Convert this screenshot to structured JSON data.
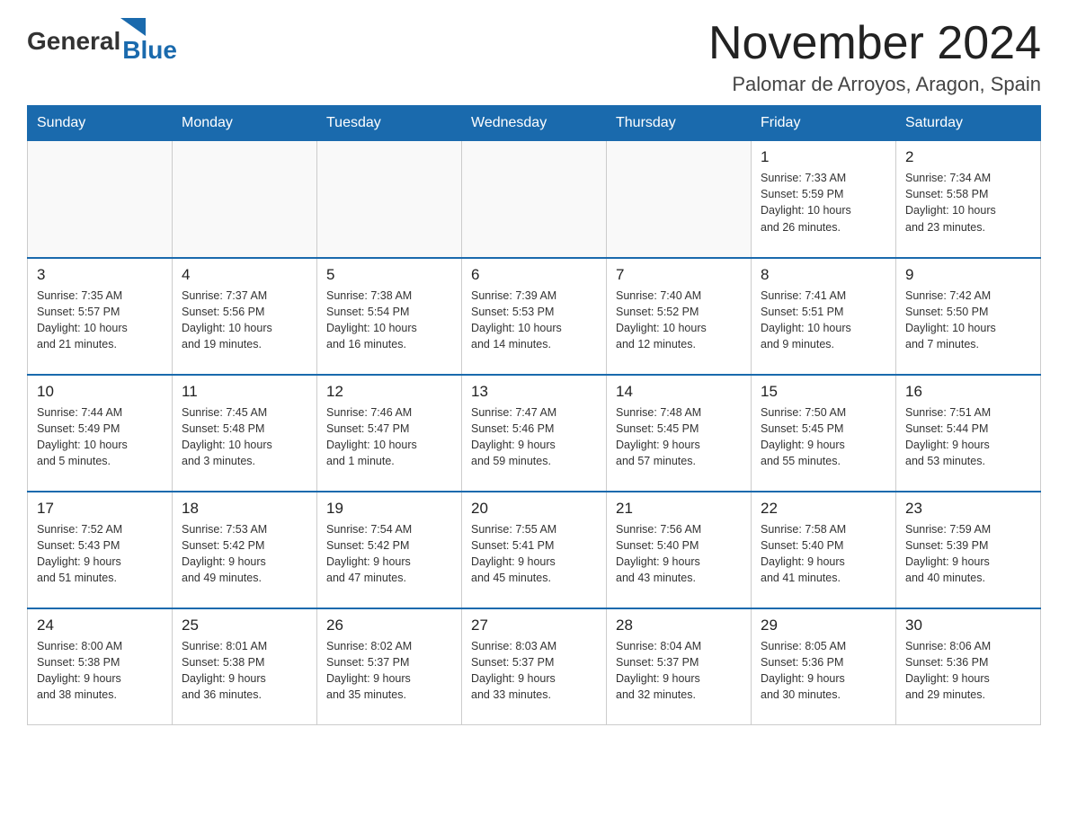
{
  "header": {
    "logo_general": "General",
    "logo_blue": "Blue",
    "month_title": "November 2024",
    "location": "Palomar de Arroyos, Aragon, Spain"
  },
  "days_of_week": [
    "Sunday",
    "Monday",
    "Tuesday",
    "Wednesday",
    "Thursday",
    "Friday",
    "Saturday"
  ],
  "weeks": [
    [
      {
        "day": "",
        "info": ""
      },
      {
        "day": "",
        "info": ""
      },
      {
        "day": "",
        "info": ""
      },
      {
        "day": "",
        "info": ""
      },
      {
        "day": "",
        "info": ""
      },
      {
        "day": "1",
        "info": "Sunrise: 7:33 AM\nSunset: 5:59 PM\nDaylight: 10 hours\nand 26 minutes."
      },
      {
        "day": "2",
        "info": "Sunrise: 7:34 AM\nSunset: 5:58 PM\nDaylight: 10 hours\nand 23 minutes."
      }
    ],
    [
      {
        "day": "3",
        "info": "Sunrise: 7:35 AM\nSunset: 5:57 PM\nDaylight: 10 hours\nand 21 minutes."
      },
      {
        "day": "4",
        "info": "Sunrise: 7:37 AM\nSunset: 5:56 PM\nDaylight: 10 hours\nand 19 minutes."
      },
      {
        "day": "5",
        "info": "Sunrise: 7:38 AM\nSunset: 5:54 PM\nDaylight: 10 hours\nand 16 minutes."
      },
      {
        "day": "6",
        "info": "Sunrise: 7:39 AM\nSunset: 5:53 PM\nDaylight: 10 hours\nand 14 minutes."
      },
      {
        "day": "7",
        "info": "Sunrise: 7:40 AM\nSunset: 5:52 PM\nDaylight: 10 hours\nand 12 minutes."
      },
      {
        "day": "8",
        "info": "Sunrise: 7:41 AM\nSunset: 5:51 PM\nDaylight: 10 hours\nand 9 minutes."
      },
      {
        "day": "9",
        "info": "Sunrise: 7:42 AM\nSunset: 5:50 PM\nDaylight: 10 hours\nand 7 minutes."
      }
    ],
    [
      {
        "day": "10",
        "info": "Sunrise: 7:44 AM\nSunset: 5:49 PM\nDaylight: 10 hours\nand 5 minutes."
      },
      {
        "day": "11",
        "info": "Sunrise: 7:45 AM\nSunset: 5:48 PM\nDaylight: 10 hours\nand 3 minutes."
      },
      {
        "day": "12",
        "info": "Sunrise: 7:46 AM\nSunset: 5:47 PM\nDaylight: 10 hours\nand 1 minute."
      },
      {
        "day": "13",
        "info": "Sunrise: 7:47 AM\nSunset: 5:46 PM\nDaylight: 9 hours\nand 59 minutes."
      },
      {
        "day": "14",
        "info": "Sunrise: 7:48 AM\nSunset: 5:45 PM\nDaylight: 9 hours\nand 57 minutes."
      },
      {
        "day": "15",
        "info": "Sunrise: 7:50 AM\nSunset: 5:45 PM\nDaylight: 9 hours\nand 55 minutes."
      },
      {
        "day": "16",
        "info": "Sunrise: 7:51 AM\nSunset: 5:44 PM\nDaylight: 9 hours\nand 53 minutes."
      }
    ],
    [
      {
        "day": "17",
        "info": "Sunrise: 7:52 AM\nSunset: 5:43 PM\nDaylight: 9 hours\nand 51 minutes."
      },
      {
        "day": "18",
        "info": "Sunrise: 7:53 AM\nSunset: 5:42 PM\nDaylight: 9 hours\nand 49 minutes."
      },
      {
        "day": "19",
        "info": "Sunrise: 7:54 AM\nSunset: 5:42 PM\nDaylight: 9 hours\nand 47 minutes."
      },
      {
        "day": "20",
        "info": "Sunrise: 7:55 AM\nSunset: 5:41 PM\nDaylight: 9 hours\nand 45 minutes."
      },
      {
        "day": "21",
        "info": "Sunrise: 7:56 AM\nSunset: 5:40 PM\nDaylight: 9 hours\nand 43 minutes."
      },
      {
        "day": "22",
        "info": "Sunrise: 7:58 AM\nSunset: 5:40 PM\nDaylight: 9 hours\nand 41 minutes."
      },
      {
        "day": "23",
        "info": "Sunrise: 7:59 AM\nSunset: 5:39 PM\nDaylight: 9 hours\nand 40 minutes."
      }
    ],
    [
      {
        "day": "24",
        "info": "Sunrise: 8:00 AM\nSunset: 5:38 PM\nDaylight: 9 hours\nand 38 minutes."
      },
      {
        "day": "25",
        "info": "Sunrise: 8:01 AM\nSunset: 5:38 PM\nDaylight: 9 hours\nand 36 minutes."
      },
      {
        "day": "26",
        "info": "Sunrise: 8:02 AM\nSunset: 5:37 PM\nDaylight: 9 hours\nand 35 minutes."
      },
      {
        "day": "27",
        "info": "Sunrise: 8:03 AM\nSunset: 5:37 PM\nDaylight: 9 hours\nand 33 minutes."
      },
      {
        "day": "28",
        "info": "Sunrise: 8:04 AM\nSunset: 5:37 PM\nDaylight: 9 hours\nand 32 minutes."
      },
      {
        "day": "29",
        "info": "Sunrise: 8:05 AM\nSunset: 5:36 PM\nDaylight: 9 hours\nand 30 minutes."
      },
      {
        "day": "30",
        "info": "Sunrise: 8:06 AM\nSunset: 5:36 PM\nDaylight: 9 hours\nand 29 minutes."
      }
    ]
  ]
}
